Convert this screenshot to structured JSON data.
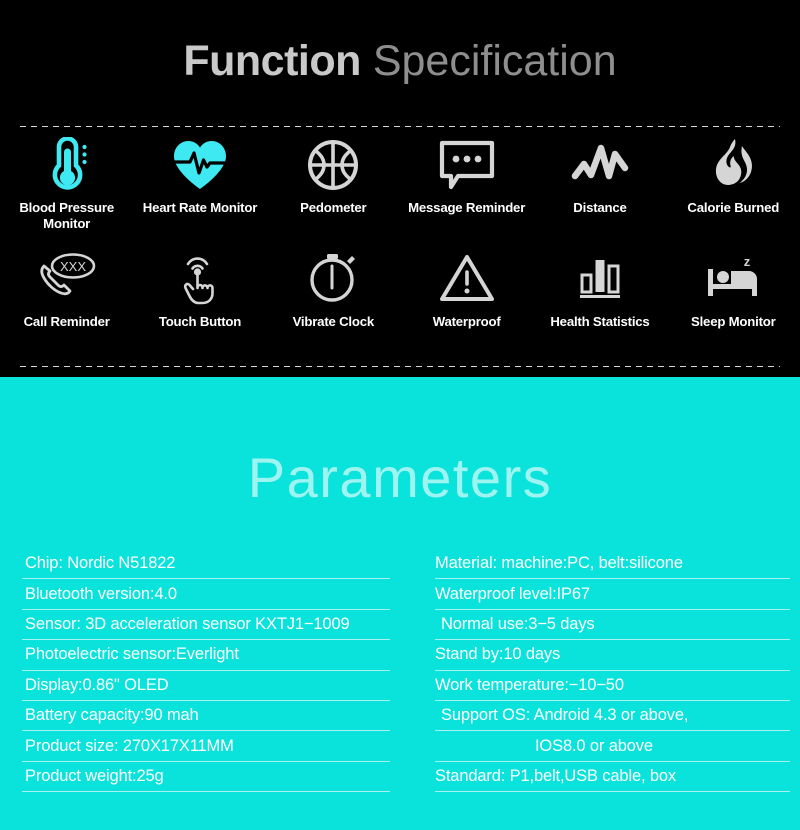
{
  "spec": {
    "title_bold": "Function",
    "title_light": " Specification",
    "features": [
      {
        "icon": "thermometer-icon",
        "label": "Blood Pressure Monitor"
      },
      {
        "icon": "heart-pulse-icon",
        "label": "Heart Rate Monitor"
      },
      {
        "icon": "pedometer-ball-icon",
        "label": "Pedometer"
      },
      {
        "icon": "message-bubble-icon",
        "label": "Message Reminder"
      },
      {
        "icon": "zigzag-route-icon",
        "label": "Distance"
      },
      {
        "icon": "flame-icon",
        "label": "Calorie Burned"
      },
      {
        "icon": "phone-call-icon",
        "label": "Call Reminder"
      },
      {
        "icon": "touch-finger-icon",
        "label": "Touch Button"
      },
      {
        "icon": "stopwatch-icon",
        "label": "Vibrate Clock"
      },
      {
        "icon": "warning-triangle-icon",
        "label": "Waterproof"
      },
      {
        "icon": "bar-chart-icon",
        "label": "Health Statistics"
      },
      {
        "icon": "bed-sleep-icon",
        "label": "Sleep Monitor"
      }
    ]
  },
  "parameters": {
    "title": "Parameters",
    "left": [
      "Chip: Nordic N51822",
      "Bluetooth version:4.0",
      "Sensor: 3D acceleration sensor KXTJ1−1009",
      "Photoelectric sensor:Everlight",
      "Display:0.86\" OLED",
      "Battery capacity:90 mah",
      "Product size: 270X17X11MM",
      "Product weight:25g"
    ],
    "right": [
      "Material: machine:PC, belt:silicone",
      "Waterproof level:IP67",
      "Normal use:3−5 days",
      "Stand by:10 days",
      "Work temperature:−10−50",
      "Support OS: Android 4.3 or above,",
      "IOS8.0 or above",
      "Standard: P1,belt,USB cable, box"
    ]
  },
  "colors": {
    "background_dark": "#000000",
    "background_cyan": "#0ae3dc",
    "accent_cyan_icon": "#3ee9f2",
    "icon_grey": "#d5d5d5",
    "text_white": "#ffffff",
    "title_grey": "#c9c9c9",
    "param_title": "#9ef4f0"
  }
}
